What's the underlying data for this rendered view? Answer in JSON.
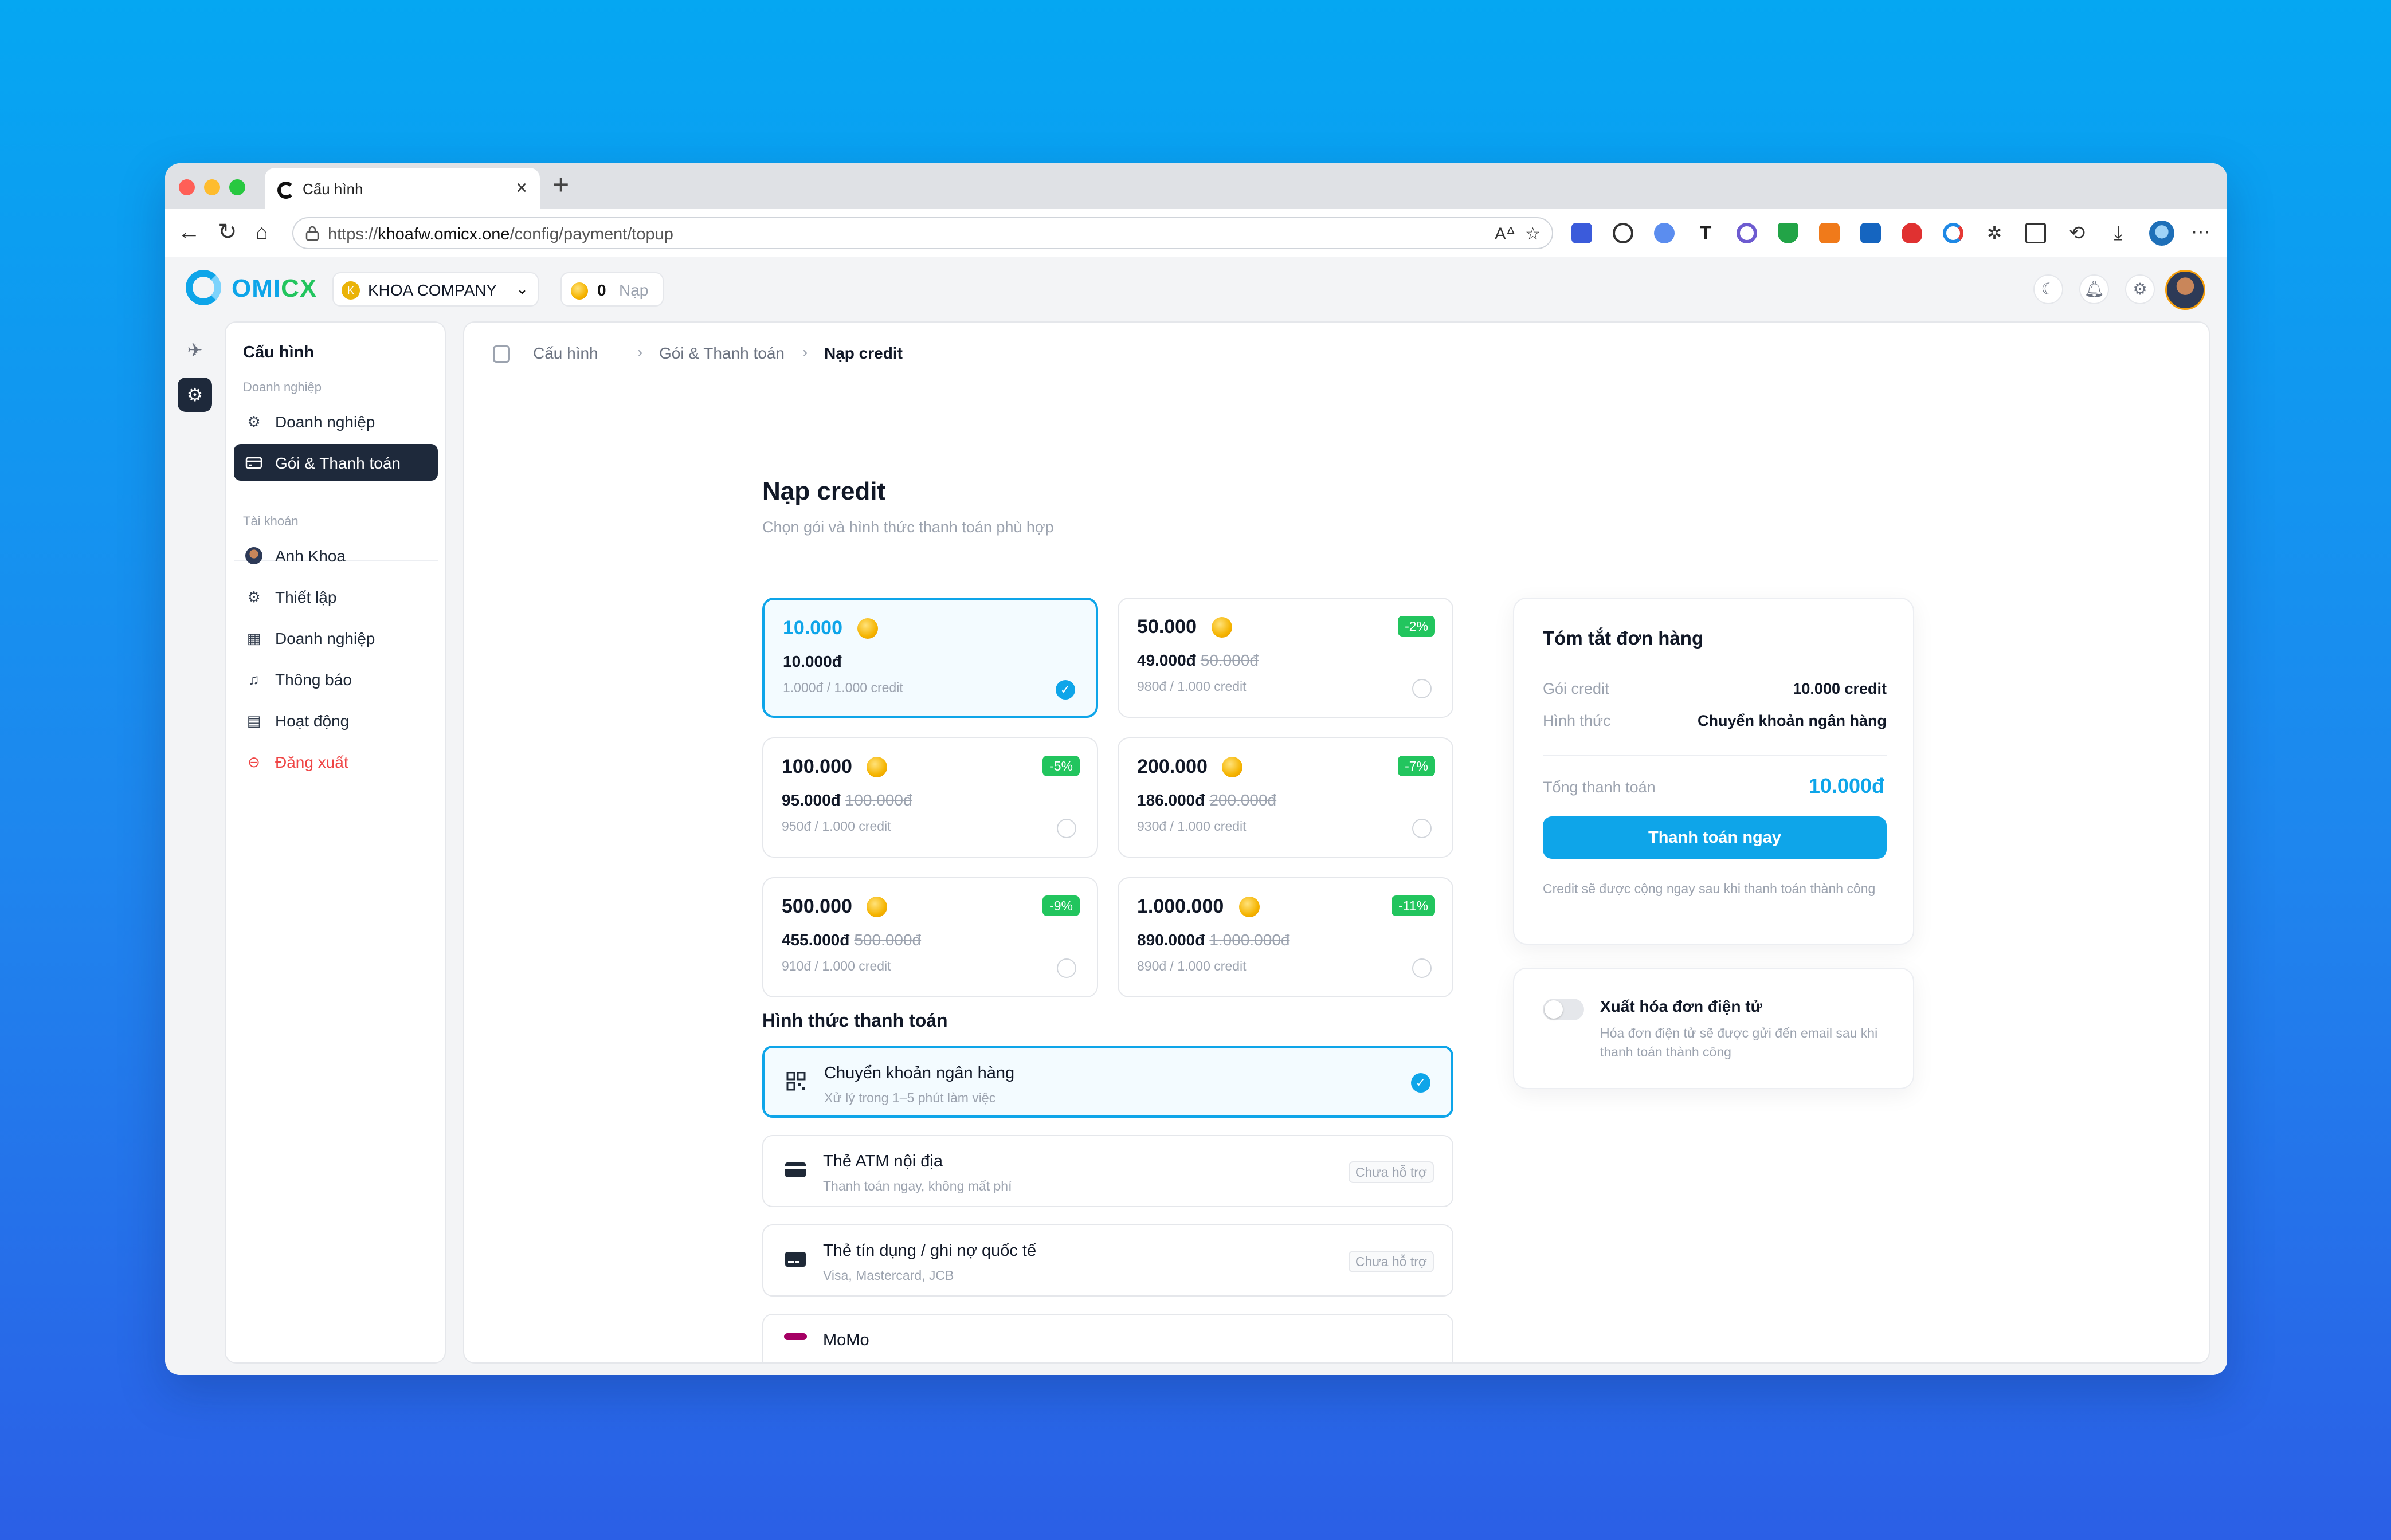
{
  "browser": {
    "tab_title": "Cấu hình",
    "url_prefix": "https://",
    "url_host": "khoafw.omicx.one",
    "url_path": "/config/payment/topup"
  },
  "topnav": {
    "logo_main": "OMI",
    "logo_accent": "CX",
    "company_initial": "K",
    "company_name": "KHOA COMPANY",
    "credit_balance": "0",
    "topup_label": "Nạp"
  },
  "sidebar": {
    "title": "Cấu hình",
    "group_business": "Doanh nghiệp",
    "business_items": [
      {
        "label": "Doanh nghiệp",
        "icon": "gear-icon"
      },
      {
        "label": "Gói & Thanh toán",
        "icon": "card-icon",
        "active": true
      }
    ],
    "group_account": "Tài khoản",
    "account_items": [
      {
        "label": "Anh Khoa",
        "icon": "avatar"
      },
      {
        "label": "Thiết lập",
        "icon": "gear-icon"
      },
      {
        "label": "Doanh nghiệp",
        "icon": "building-icon"
      },
      {
        "label": "Thông báo",
        "icon": "bell-icon"
      },
      {
        "label": "Hoạt động",
        "icon": "activity-icon"
      },
      {
        "label": "Đăng xuất",
        "icon": "logout-icon",
        "danger": true
      }
    ]
  },
  "breadcrumb": [
    "Cấu hình",
    "Gói & Thanh toán",
    "Nạp credit"
  ],
  "page": {
    "title": "Nạp credit",
    "subtitle": "Chọn gói và hình thức thanh toán phù hợp"
  },
  "packages": [
    {
      "amount": "10.000",
      "price": "10.000đ",
      "old_price": "",
      "unit": "1.000đ / 1.000 credit",
      "badge": "",
      "selected": true
    },
    {
      "amount": "50.000",
      "price": "49.000đ",
      "old_price": "50.000đ",
      "unit": "980đ / 1.000 credit",
      "badge": "-2%",
      "selected": false
    },
    {
      "amount": "100.000",
      "price": "95.000đ",
      "old_price": "100.000đ",
      "unit": "950đ / 1.000 credit",
      "badge": "-5%",
      "selected": false
    },
    {
      "amount": "200.000",
      "price": "186.000đ",
      "old_price": "200.000đ",
      "unit": "930đ / 1.000 credit",
      "badge": "-7%",
      "selected": false
    },
    {
      "amount": "500.000",
      "price": "455.000đ",
      "old_price": "500.000đ",
      "unit": "910đ / 1.000 credit",
      "badge": "-9%",
      "selected": false
    },
    {
      "amount": "1.000.000",
      "price": "890.000đ",
      "old_price": "1.000.000đ",
      "unit": "890đ / 1.000 credit",
      "badge": "-11%",
      "selected": false
    }
  ],
  "payment": {
    "section_title": "Hình thức thanh toán",
    "methods": [
      {
        "name": "Chuyển khoản ngân hàng",
        "desc": "Xử lý trong 1–5 phút làm việc",
        "status": "",
        "icon": "qr-icon",
        "selected": true
      },
      {
        "name": "Thẻ ATM nội địa",
        "desc": "Thanh toán ngay, không mất phí",
        "status": "Chưa hỗ trợ",
        "icon": "card-icon",
        "selected": false
      },
      {
        "name": "Thẻ tín dụng / ghi nợ quốc tế",
        "desc": "Visa, Mastercard, JCB",
        "status": "Chưa hỗ trợ",
        "icon": "credit-card-icon",
        "selected": false
      },
      {
        "name": "MoMo",
        "desc": "",
        "status": "",
        "icon": "momo-icon",
        "selected": false
      }
    ]
  },
  "summary": {
    "title": "Tóm tắt đơn hàng",
    "package_label": "Gói credit",
    "package_value": "10.000 credit",
    "method_label": "Hình thức",
    "method_value": "Chuyển khoản ngân hàng",
    "total_label": "Tổng thanh toán",
    "total_value": "10.000đ",
    "pay_button": "Thanh toán ngay",
    "note": "Credit sẽ được cộng ngay sau khi thanh toán thành công"
  },
  "invoice": {
    "title": "Xuất hóa đơn điện tử",
    "desc": "Hóa đơn điện tử sẽ được gửi đến email sau khi thanh toán thành công",
    "enabled": false
  },
  "colors": {
    "accent": "#0ea5e9",
    "sidebar_active": "#1e293b",
    "discount_badge": "#22c55e",
    "danger": "#ef4444"
  }
}
